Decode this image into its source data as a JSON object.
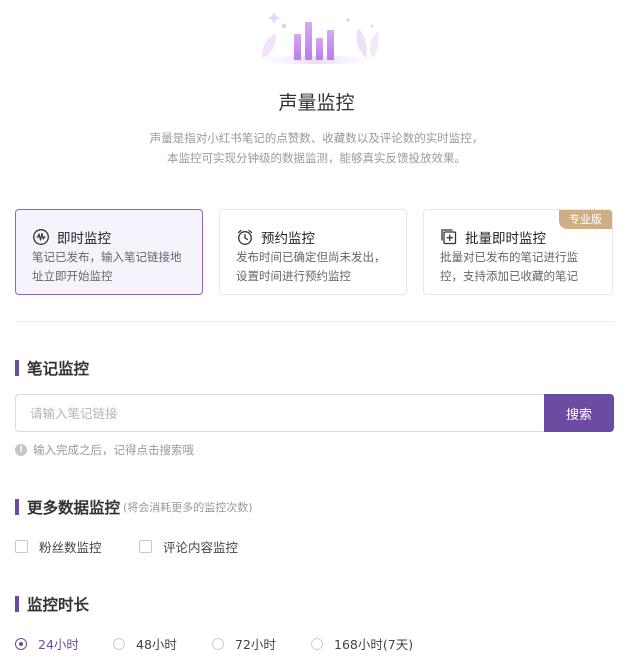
{
  "header": {
    "icon": "bar-chart-illustration",
    "title": "声量监控",
    "description_lines": [
      "声量是指对小红书笔记的点赞数、收藏数以及评论数的实时监控，",
      "本监控可实现分钟级的数据监测，能够真实反馈投放效果。"
    ]
  },
  "monitor_types": [
    {
      "title": "即时监控",
      "icon": "waveform-icon",
      "desc_lines": [
        "笔记已发布，输入笔记链接地",
        "址立即开始监控"
      ],
      "selected": true
    },
    {
      "title": "预约监控",
      "icon": "alarm-clock-icon",
      "desc_lines": [
        "发布时间已确定但尚未发出，",
        "设置时间进行预约监控"
      ],
      "selected": false
    },
    {
      "title": "批量即时监控",
      "icon": "batch-add-icon",
      "desc_lines": [
        "批量对已发布的笔记进行监",
        "控，支持添加已收藏的笔记"
      ],
      "badge": "专业版",
      "selected": false
    }
  ],
  "note_monitor": {
    "section_title": "笔记监控",
    "search_placeholder": "请输入笔记链接",
    "search_value": "",
    "search_button": "搜索",
    "hint": "输入完成之后，记得点击搜索哦",
    "hint_icon": "info-icon"
  },
  "more_data": {
    "section_title": "更多数据监控",
    "note": "(将会消耗更多的监控次数)",
    "options": [
      {
        "label": "粉丝数监控",
        "checked": false
      },
      {
        "label": "评论内容监控",
        "checked": false
      }
    ]
  },
  "duration": {
    "section_title": "监控时长",
    "options": [
      {
        "label": "24小时",
        "selected": true
      },
      {
        "label": "48小时",
        "selected": false
      },
      {
        "label": "72小时",
        "selected": false
      },
      {
        "label": "168小时(7天)",
        "selected": false
      }
    ]
  },
  "colors": {
    "accent": "#6c4ba3",
    "badge": "#cfae86",
    "active_card_bg": "#f7f3fc"
  }
}
